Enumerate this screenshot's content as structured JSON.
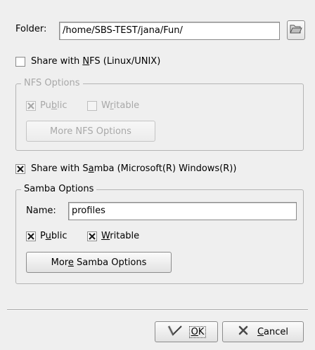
{
  "folder": {
    "label_before": "F",
    "label_mnemonic": "o",
    "label_after": "lder:",
    "path": "/home/SBS-TEST/jana/Fun/",
    "browse_icon": "folder-open-icon"
  },
  "nfs": {
    "share_before": "Share with ",
    "share_mnemonic": "N",
    "share_after": "FS (Linux/UNIX)",
    "share_checked": false,
    "group_title": "NFS Options",
    "public_before": "Pu",
    "public_mnemonic": "b",
    "public_after": "lic",
    "public_checked": true,
    "writable_before": "W",
    "writable_mnemonic": "r",
    "writable_after": "itable",
    "writable_checked": false,
    "more_button": "More NFS Options"
  },
  "samba": {
    "share_before": "Share with S",
    "share_mnemonic": "a",
    "share_after": "mba (Microsoft(R) Windows(R))",
    "share_checked": true,
    "group_title": "Samba Options",
    "name_label": "Name:",
    "name_value": "profiles",
    "public_before": "P",
    "public_mnemonic": "u",
    "public_after": "blic",
    "public_checked": true,
    "writable_before": "",
    "writable_mnemonic": "W",
    "writable_after": "ritable",
    "writable_checked": true,
    "more_before": "Mor",
    "more_mnemonic": "e",
    "more_after": " Samba Options"
  },
  "buttons": {
    "ok_mnemonic": "O",
    "ok_after": "K",
    "ok_icon": "checkmark-icon",
    "cancel_mnemonic": "C",
    "cancel_after": "ancel",
    "cancel_icon": "cancel-x-icon"
  }
}
